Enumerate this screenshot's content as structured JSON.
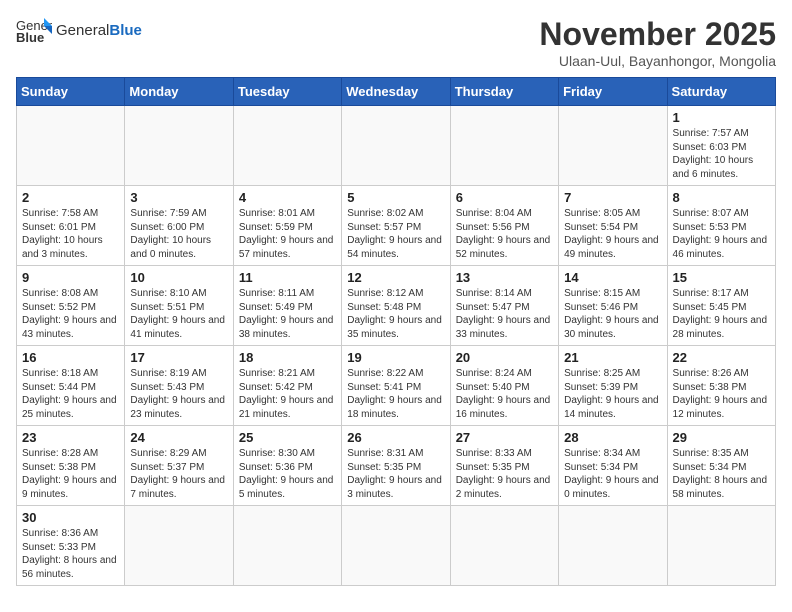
{
  "header": {
    "logo_text_normal": "General",
    "logo_text_bold": "Blue",
    "month_title": "November 2025",
    "location": "Ulaan-Uul, Bayanhongor, Mongolia"
  },
  "days_of_week": [
    "Sunday",
    "Monday",
    "Tuesday",
    "Wednesday",
    "Thursday",
    "Friday",
    "Saturday"
  ],
  "weeks": [
    [
      {
        "day": "",
        "info": ""
      },
      {
        "day": "",
        "info": ""
      },
      {
        "day": "",
        "info": ""
      },
      {
        "day": "",
        "info": ""
      },
      {
        "day": "",
        "info": ""
      },
      {
        "day": "",
        "info": ""
      },
      {
        "day": "1",
        "info": "Sunrise: 7:57 AM\nSunset: 6:03 PM\nDaylight: 10 hours and 6 minutes."
      }
    ],
    [
      {
        "day": "2",
        "info": "Sunrise: 7:58 AM\nSunset: 6:01 PM\nDaylight: 10 hours and 3 minutes."
      },
      {
        "day": "3",
        "info": "Sunrise: 7:59 AM\nSunset: 6:00 PM\nDaylight: 10 hours and 0 minutes."
      },
      {
        "day": "4",
        "info": "Sunrise: 8:01 AM\nSunset: 5:59 PM\nDaylight: 9 hours and 57 minutes."
      },
      {
        "day": "5",
        "info": "Sunrise: 8:02 AM\nSunset: 5:57 PM\nDaylight: 9 hours and 54 minutes."
      },
      {
        "day": "6",
        "info": "Sunrise: 8:04 AM\nSunset: 5:56 PM\nDaylight: 9 hours and 52 minutes."
      },
      {
        "day": "7",
        "info": "Sunrise: 8:05 AM\nSunset: 5:54 PM\nDaylight: 9 hours and 49 minutes."
      },
      {
        "day": "8",
        "info": "Sunrise: 8:07 AM\nSunset: 5:53 PM\nDaylight: 9 hours and 46 minutes."
      }
    ],
    [
      {
        "day": "9",
        "info": "Sunrise: 8:08 AM\nSunset: 5:52 PM\nDaylight: 9 hours and 43 minutes."
      },
      {
        "day": "10",
        "info": "Sunrise: 8:10 AM\nSunset: 5:51 PM\nDaylight: 9 hours and 41 minutes."
      },
      {
        "day": "11",
        "info": "Sunrise: 8:11 AM\nSunset: 5:49 PM\nDaylight: 9 hours and 38 minutes."
      },
      {
        "day": "12",
        "info": "Sunrise: 8:12 AM\nSunset: 5:48 PM\nDaylight: 9 hours and 35 minutes."
      },
      {
        "day": "13",
        "info": "Sunrise: 8:14 AM\nSunset: 5:47 PM\nDaylight: 9 hours and 33 minutes."
      },
      {
        "day": "14",
        "info": "Sunrise: 8:15 AM\nSunset: 5:46 PM\nDaylight: 9 hours and 30 minutes."
      },
      {
        "day": "15",
        "info": "Sunrise: 8:17 AM\nSunset: 5:45 PM\nDaylight: 9 hours and 28 minutes."
      }
    ],
    [
      {
        "day": "16",
        "info": "Sunrise: 8:18 AM\nSunset: 5:44 PM\nDaylight: 9 hours and 25 minutes."
      },
      {
        "day": "17",
        "info": "Sunrise: 8:19 AM\nSunset: 5:43 PM\nDaylight: 9 hours and 23 minutes."
      },
      {
        "day": "18",
        "info": "Sunrise: 8:21 AM\nSunset: 5:42 PM\nDaylight: 9 hours and 21 minutes."
      },
      {
        "day": "19",
        "info": "Sunrise: 8:22 AM\nSunset: 5:41 PM\nDaylight: 9 hours and 18 minutes."
      },
      {
        "day": "20",
        "info": "Sunrise: 8:24 AM\nSunset: 5:40 PM\nDaylight: 9 hours and 16 minutes."
      },
      {
        "day": "21",
        "info": "Sunrise: 8:25 AM\nSunset: 5:39 PM\nDaylight: 9 hours and 14 minutes."
      },
      {
        "day": "22",
        "info": "Sunrise: 8:26 AM\nSunset: 5:38 PM\nDaylight: 9 hours and 12 minutes."
      }
    ],
    [
      {
        "day": "23",
        "info": "Sunrise: 8:28 AM\nSunset: 5:38 PM\nDaylight: 9 hours and 9 minutes."
      },
      {
        "day": "24",
        "info": "Sunrise: 8:29 AM\nSunset: 5:37 PM\nDaylight: 9 hours and 7 minutes."
      },
      {
        "day": "25",
        "info": "Sunrise: 8:30 AM\nSunset: 5:36 PM\nDaylight: 9 hours and 5 minutes."
      },
      {
        "day": "26",
        "info": "Sunrise: 8:31 AM\nSunset: 5:35 PM\nDaylight: 9 hours and 3 minutes."
      },
      {
        "day": "27",
        "info": "Sunrise: 8:33 AM\nSunset: 5:35 PM\nDaylight: 9 hours and 2 minutes."
      },
      {
        "day": "28",
        "info": "Sunrise: 8:34 AM\nSunset: 5:34 PM\nDaylight: 9 hours and 0 minutes."
      },
      {
        "day": "29",
        "info": "Sunrise: 8:35 AM\nSunset: 5:34 PM\nDaylight: 8 hours and 58 minutes."
      }
    ],
    [
      {
        "day": "30",
        "info": "Sunrise: 8:36 AM\nSunset: 5:33 PM\nDaylight: 8 hours and 56 minutes."
      },
      {
        "day": "",
        "info": ""
      },
      {
        "day": "",
        "info": ""
      },
      {
        "day": "",
        "info": ""
      },
      {
        "day": "",
        "info": ""
      },
      {
        "day": "",
        "info": ""
      },
      {
        "day": "",
        "info": ""
      }
    ]
  ]
}
